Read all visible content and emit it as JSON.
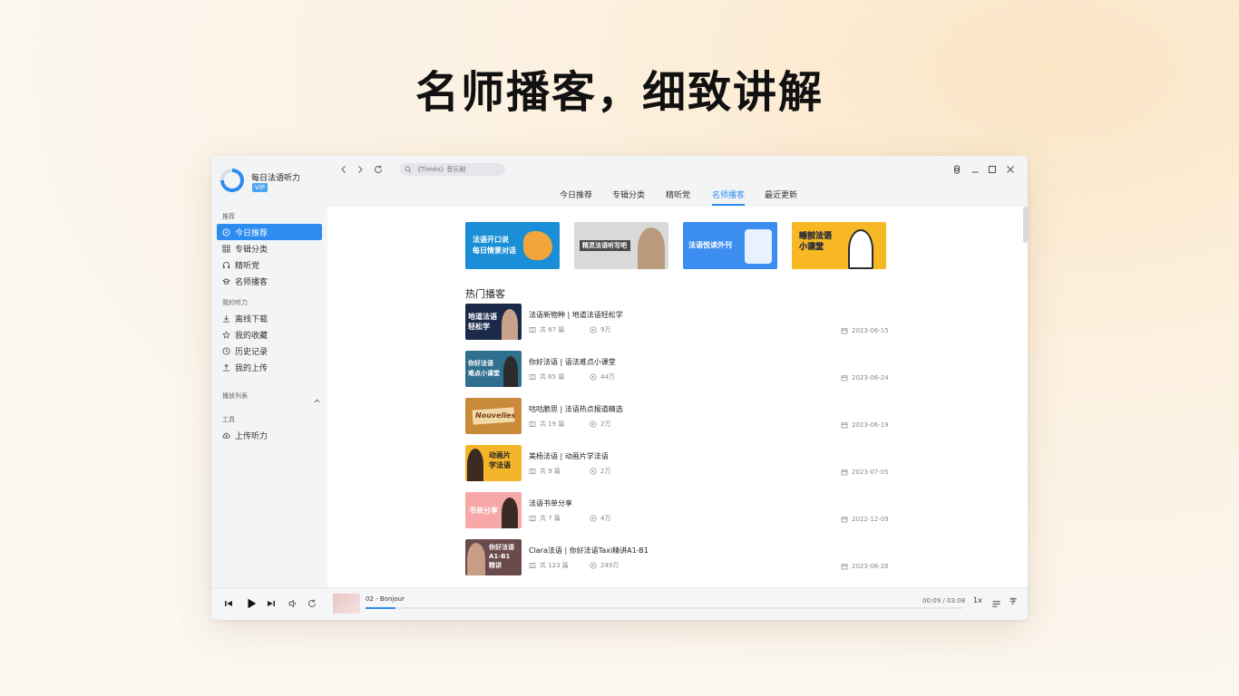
{
  "headline": "名师播客，细致讲解",
  "app": {
    "name": "每日法语听力",
    "vip": "VIP"
  },
  "sidebar": {
    "section_recommend": "推荐",
    "section_mine": "我的听力",
    "section_playlist": "播放列表",
    "section_tools": "工具",
    "items": [
      {
        "label": "今日推荐",
        "icon": "compass-icon",
        "active": true
      },
      {
        "label": "专辑分类",
        "icon": "grid-icon"
      },
      {
        "label": "精听党",
        "icon": "headphones-icon"
      },
      {
        "label": "名师播客",
        "icon": "graduation-cap-icon"
      },
      {
        "label": "离线下载",
        "icon": "download-icon"
      },
      {
        "label": "我的收藏",
        "icon": "star-icon"
      },
      {
        "label": "历史记录",
        "icon": "clock-icon"
      },
      {
        "label": "我的上传",
        "icon": "upload-icon"
      },
      {
        "label": "上传听力",
        "icon": "cloud-upload-icon"
      }
    ]
  },
  "search": {
    "placeholder": "《Timéo》音乐剧"
  },
  "tabs": [
    {
      "label": "今日推荐"
    },
    {
      "label": "专辑分类"
    },
    {
      "label": "精听党"
    },
    {
      "label": "名师播客",
      "active": true
    },
    {
      "label": "最近更新"
    }
  ],
  "banners": [
    {
      "text": "法语开口说\n每日情景对话",
      "bg": "#1a8ed6",
      "color": "#ffffff"
    },
    {
      "text": "精灵法语听写吧",
      "bg": "#d9d9d9",
      "color": "#ffffff"
    },
    {
      "text": "法语悦读外刊",
      "bg": "#3b8df0",
      "color": "#ffffff"
    },
    {
      "text": "睡前法语\n小课堂",
      "bg": "#f7b824",
      "color": "#ffffff"
    }
  ],
  "section_title": "热门播客",
  "podcasts": [
    {
      "title": "法语新物种 | 地道法语轻松学",
      "episodes": "共 87 篇",
      "plays": "9万",
      "date": "2023-06-15",
      "thumb_text": "地道法语\n轻松学",
      "thumb_bg": "#1c2a4a",
      "thumb_color": "#ffffff"
    },
    {
      "title": "你好法语 | 语法难点小课堂",
      "episodes": "共 65 篇",
      "plays": "44万",
      "date": "2023-06-24",
      "thumb_text": "你好法语\n难点小课堂",
      "thumb_bg": "#2f6f8f",
      "thumb_color": "#ffffff"
    },
    {
      "title": "咕咕脆思 | 法语热点报道精选",
      "episodes": "共 19 篇",
      "plays": "2万",
      "date": "2023-06-19",
      "thumb_text": "Nouvelles",
      "thumb_bg": "#c98a3a",
      "thumb_color": "#ffffff"
    },
    {
      "title": "美杨法语 | 动画片学法语",
      "episodes": "共 9 篇",
      "plays": "2万",
      "date": "2023-07-05",
      "thumb_text": "动画片\n学法语",
      "thumb_bg": "#f4b52b",
      "thumb_color": "#222222"
    },
    {
      "title": "法语书单分享",
      "episodes": "共 7 篇",
      "plays": "4万",
      "date": "2022-12-09",
      "thumb_text": "书单分享",
      "thumb_bg": "#f6a8a8",
      "thumb_color": "#ffffff"
    },
    {
      "title": "Clara法语 | 你好法语Taxi精讲A1-B1",
      "episodes": "共 123 篇",
      "plays": "249万",
      "date": "2023-06-26",
      "thumb_text": "你好法语\nA1-B1\n精讲",
      "thumb_bg": "#6a4a4a",
      "thumb_color": "#ffffff"
    }
  ],
  "player": {
    "track": "02 - Bonjour",
    "time": "00:09 / 03:08",
    "progress": 0.05,
    "speed": "1x",
    "lyrics": "字"
  },
  "colors": {
    "accent": "#2d8cf0",
    "sidebar_bg": "#f3f4f6"
  }
}
